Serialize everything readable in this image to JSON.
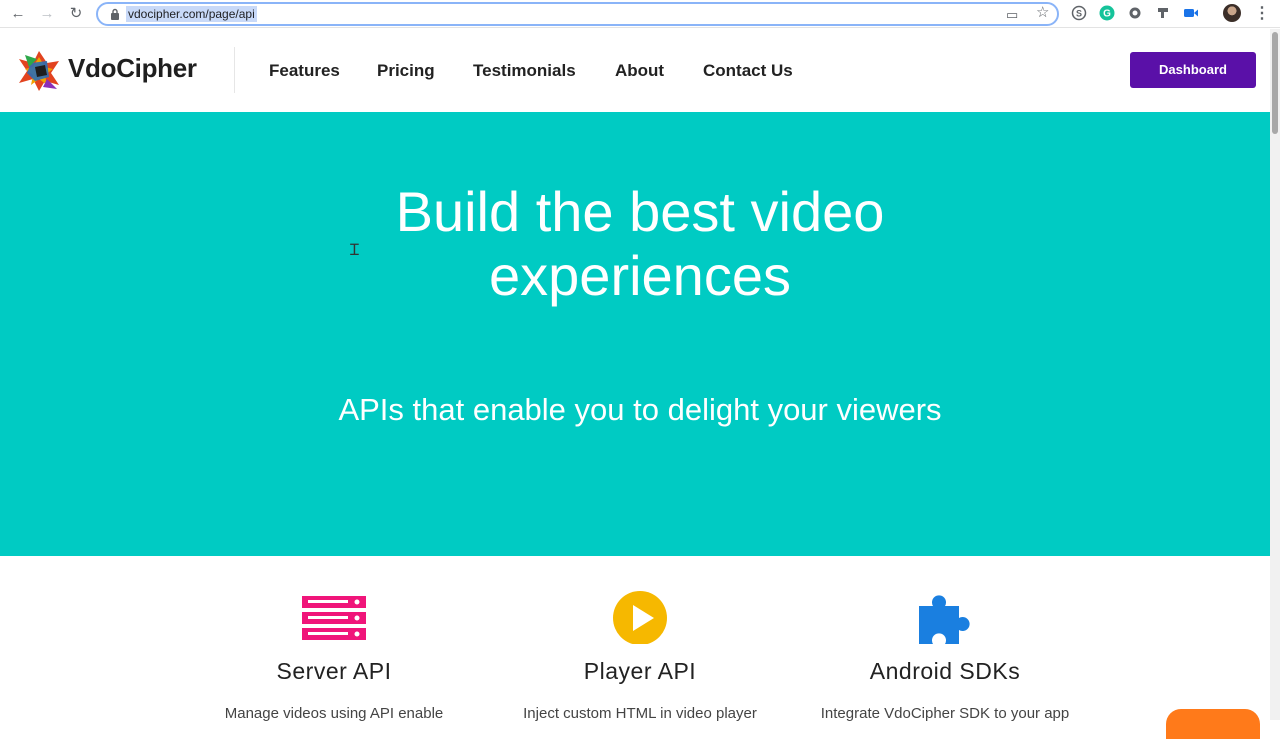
{
  "browser": {
    "url": "vdocipher.com/page/api",
    "back_icon": "←",
    "forward_icon": "→",
    "reload_icon": "↻",
    "cast_icon": "▭",
    "star_icon": "☆",
    "menu_icon": "⋮"
  },
  "header": {
    "brand": "VdoCipher",
    "nav": [
      "Features",
      "Pricing",
      "Testimonials",
      "About",
      "Contact Us"
    ],
    "dashboard_label": "Dashboard"
  },
  "hero": {
    "title_line1": "Build the best video",
    "title_line2": "experiences",
    "subtitle": "APIs that enable you to delight your viewers",
    "cursor_glyph": "Ɪ"
  },
  "features": [
    {
      "title": "Server API",
      "description": "Manage videos using API enable",
      "icon": "server-icon",
      "color": "#f0157a"
    },
    {
      "title": "Player API",
      "description": "Inject custom HTML in video player",
      "icon": "play-icon",
      "color": "#f6b800"
    },
    {
      "title": "Android SDKs",
      "description": "Integrate VdoCipher SDK to your app",
      "icon": "puzzle-icon",
      "color": "#1a7fe0"
    }
  ],
  "colors": {
    "hero_bg": "#00cbc3",
    "dashboard_bg": "#5a10a8",
    "accent_orange": "#ff7a1a"
  }
}
